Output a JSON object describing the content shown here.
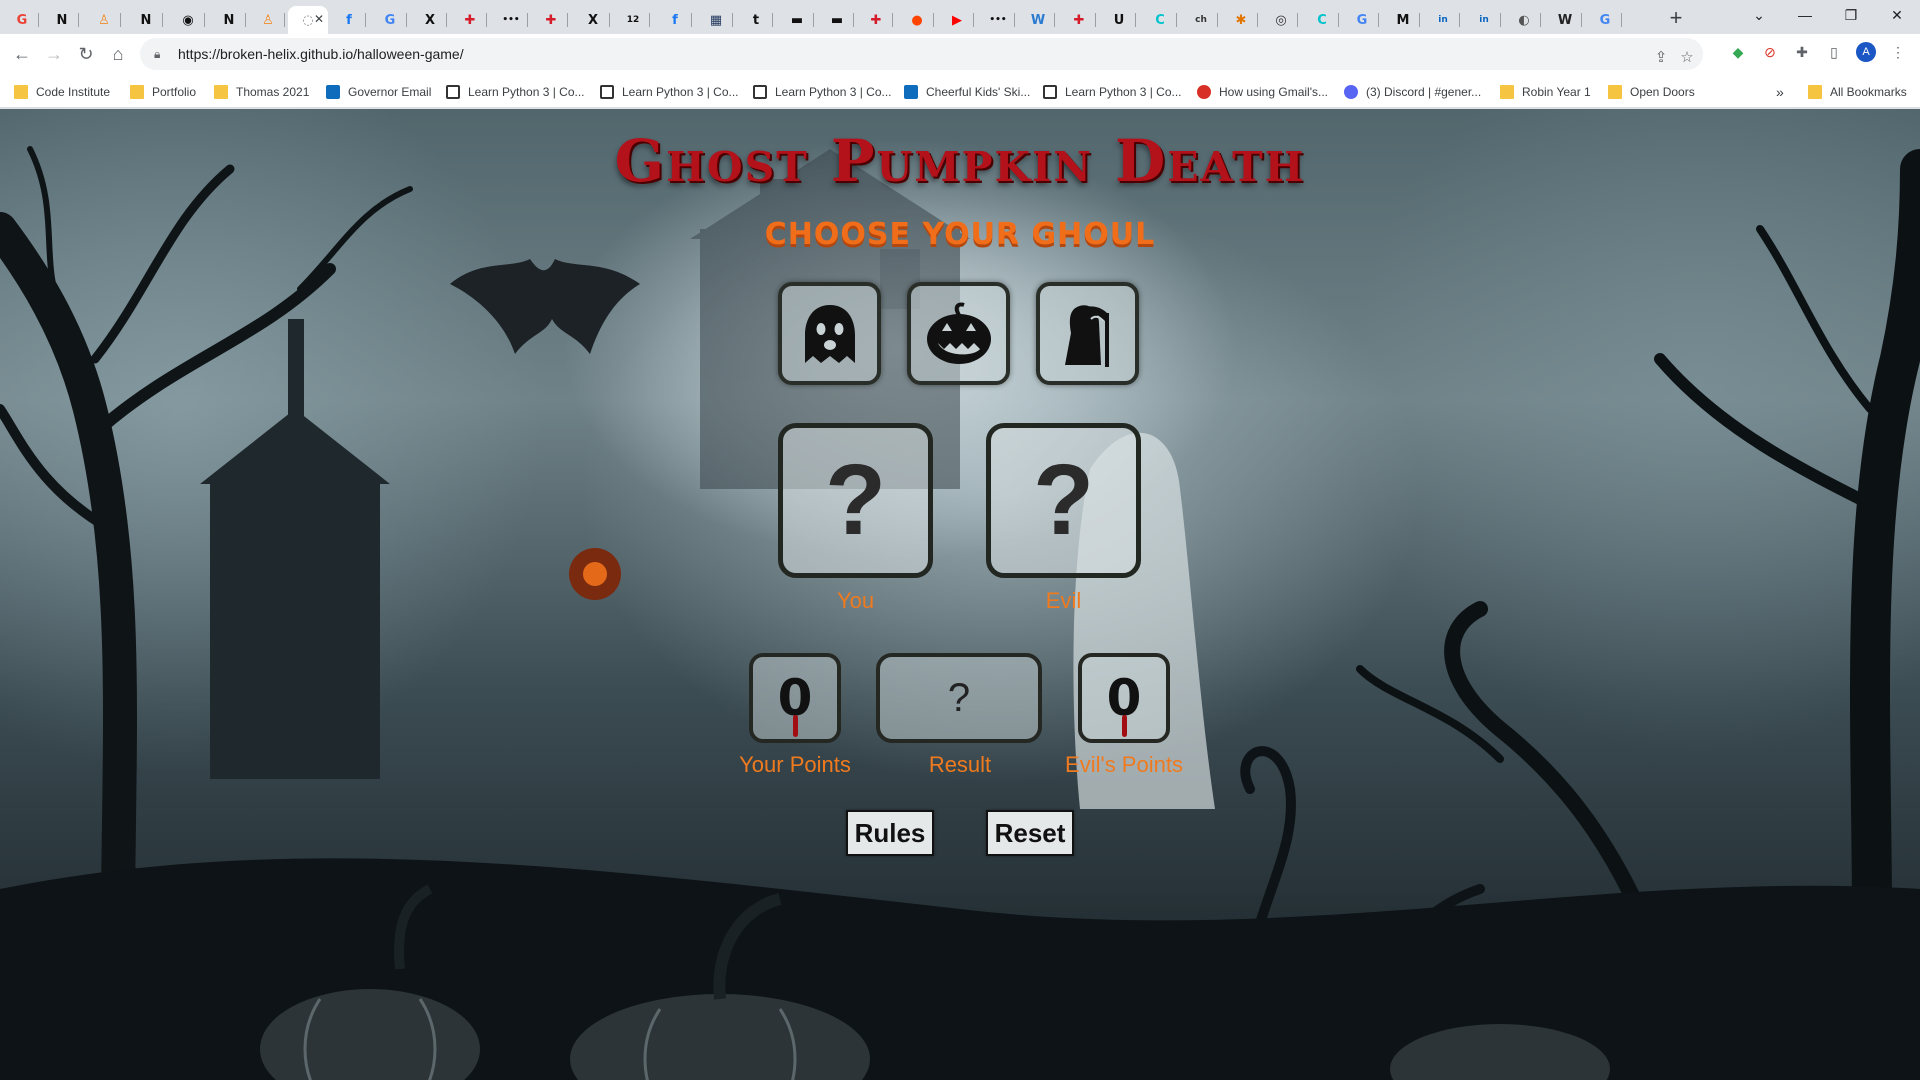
{
  "browser": {
    "url": "https://broken-helix.github.io/halloween-game/",
    "tabs": [
      {
        "icon": "google-icon",
        "glyph": "G",
        "color": "#ea4335"
      },
      {
        "icon": "notion-icon",
        "glyph": "N",
        "color": "#111111"
      },
      {
        "icon": "person-icon",
        "glyph": "♙",
        "color": "#f08a24"
      },
      {
        "icon": "notion-icon",
        "glyph": "N",
        "color": "#111111"
      },
      {
        "icon": "github-icon",
        "glyph": "◉",
        "color": "#111111"
      },
      {
        "icon": "notion-icon",
        "glyph": "N",
        "color": "#111111"
      },
      {
        "icon": "person-icon",
        "glyph": "♙",
        "color": "#f08a24"
      },
      {
        "icon": "loading-icon",
        "glyph": "◌",
        "color": "#888888"
      },
      {
        "icon": "facebook-icon",
        "glyph": "f",
        "color": "#1877f2"
      },
      {
        "icon": "google-icon",
        "glyph": "G",
        "color": "#4285f4"
      },
      {
        "icon": "x-icon",
        "glyph": "X",
        "color": "#111111"
      },
      {
        "icon": "slack-icon",
        "glyph": "✚",
        "color": "#d41c2b"
      },
      {
        "icon": "dots-icon",
        "glyph": "•••",
        "color": "#111111"
      },
      {
        "icon": "slack-icon",
        "glyph": "✚",
        "color": "#d41c2b"
      },
      {
        "icon": "x-icon",
        "glyph": "X",
        "color": "#111111"
      },
      {
        "icon": "number-icon",
        "glyph": "12",
        "color": "#111111"
      },
      {
        "icon": "facebook-icon",
        "glyph": "f",
        "color": "#1877f2"
      },
      {
        "icon": "grid-icon",
        "glyph": "▦",
        "color": "#223a5e"
      },
      {
        "icon": "tumblr-icon",
        "glyph": "t",
        "color": "#111111"
      },
      {
        "icon": "tape-icon",
        "glyph": "▬",
        "color": "#111111"
      },
      {
        "icon": "tape-icon",
        "glyph": "▬",
        "color": "#111111"
      },
      {
        "icon": "slack-icon",
        "glyph": "✚",
        "color": "#d41c2b"
      },
      {
        "icon": "reddit-icon",
        "glyph": "●",
        "color": "#ff4500"
      },
      {
        "icon": "youtube-icon",
        "glyph": "▶",
        "color": "#ff0000"
      },
      {
        "icon": "dots-icon",
        "glyph": "•••",
        "color": "#111111"
      },
      {
        "icon": "w3-icon",
        "glyph": "W",
        "color": "#2b7bd2"
      },
      {
        "icon": "slack-icon",
        "glyph": "✚",
        "color": "#d41c2b"
      },
      {
        "icon": "udemy-icon",
        "glyph": "U",
        "color": "#111111"
      },
      {
        "icon": "canva-icon",
        "glyph": "C",
        "color": "#00c4cc"
      },
      {
        "icon": "text-icon",
        "glyph": "ch",
        "color": "#333333"
      },
      {
        "icon": "puzzle-icon",
        "glyph": "✱",
        "color": "#e37400"
      },
      {
        "icon": "chatgpt-icon",
        "glyph": "◎",
        "color": "#333333"
      },
      {
        "icon": "canva-icon",
        "glyph": "C",
        "color": "#00c4cc"
      },
      {
        "icon": "google-icon",
        "glyph": "G",
        "color": "#4285f4"
      },
      {
        "icon": "medium-icon",
        "glyph": "M",
        "color": "#111111"
      },
      {
        "icon": "linkedin-icon",
        "glyph": "in",
        "color": "#0a66c2"
      },
      {
        "icon": "linkedin-icon",
        "glyph": "in",
        "color": "#0a66c2"
      },
      {
        "icon": "globe-icon",
        "glyph": "◐",
        "color": "#555555"
      },
      {
        "icon": "wolf-icon",
        "glyph": "W",
        "color": "#222222"
      },
      {
        "icon": "google-icon",
        "glyph": "G",
        "color": "#4285f4"
      }
    ],
    "bookmarks": [
      {
        "label": "Code Institute",
        "icon": "folder"
      },
      {
        "label": "Portfolio",
        "icon": "folder"
      },
      {
        "label": "Thomas 2021",
        "icon": "folder"
      },
      {
        "label": "Governor Email",
        "icon": "blue"
      },
      {
        "label": "Learn Python 3 | Co...",
        "icon": "doc"
      },
      {
        "label": "Learn Python 3 | Co...",
        "icon": "doc"
      },
      {
        "label": "Learn Python 3 | Co...",
        "icon": "doc"
      },
      {
        "label": "Cheerful Kids' Ski...",
        "icon": "blue"
      },
      {
        "label": "Learn Python 3 | Co...",
        "icon": "doc"
      },
      {
        "label": "How using Gmail's...",
        "icon": "red"
      },
      {
        "label": "(3) Discord | #gener...",
        "icon": "discord"
      },
      {
        "label": "Robin Year 1",
        "icon": "folder"
      },
      {
        "label": "Open Doors",
        "icon": "folder"
      }
    ],
    "all_bookmarks": "All Bookmarks",
    "more_bookmarks": "»"
  },
  "game": {
    "title": "Ghost Pumpkin Death",
    "subtitle": "CHOOSE YOUR GHOUL",
    "choices": [
      {
        "name": "ghost",
        "icon": "ghost-icon"
      },
      {
        "name": "pumpkin",
        "icon": "jack-o-lantern-icon"
      },
      {
        "name": "death",
        "icon": "grim-reaper-icon"
      }
    ],
    "player_choice": "?",
    "evil_choice": "?",
    "player_label": "You",
    "evil_label": "Evil",
    "player_points": "0",
    "evil_points": "0",
    "result": "?",
    "player_points_label": "Your Points",
    "result_label": "Result",
    "evil_points_label": "Evil's Points",
    "rules_button": "Rules",
    "reset_button": "Reset",
    "colors": {
      "title": "#b3121b",
      "accent": "#f06d1a"
    }
  }
}
